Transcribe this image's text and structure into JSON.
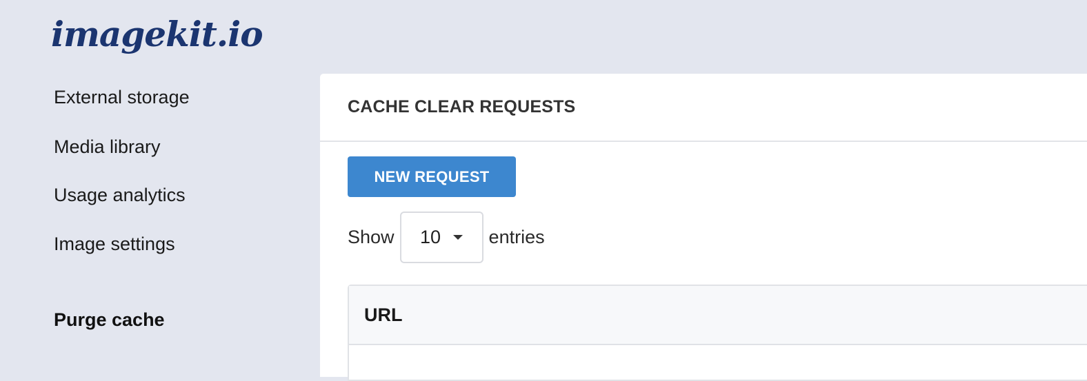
{
  "brand": {
    "logo_text": "imagekit.io"
  },
  "sidebar": {
    "items": [
      {
        "label": "External storage"
      },
      {
        "label": "Media library"
      },
      {
        "label": "Usage analytics"
      },
      {
        "label": "Image settings"
      },
      {
        "label": "Purge cache",
        "active": true
      }
    ]
  },
  "main": {
    "title": "CACHE CLEAR REQUESTS",
    "new_request_label": "NEW REQUEST",
    "entries": {
      "prefix": "Show",
      "value": "10",
      "suffix": "entries"
    },
    "table": {
      "columns": [
        "URL"
      ]
    }
  },
  "colors": {
    "background": "#e3e6ef",
    "brand": "#1b3570",
    "primary_button": "#3d87cf"
  }
}
